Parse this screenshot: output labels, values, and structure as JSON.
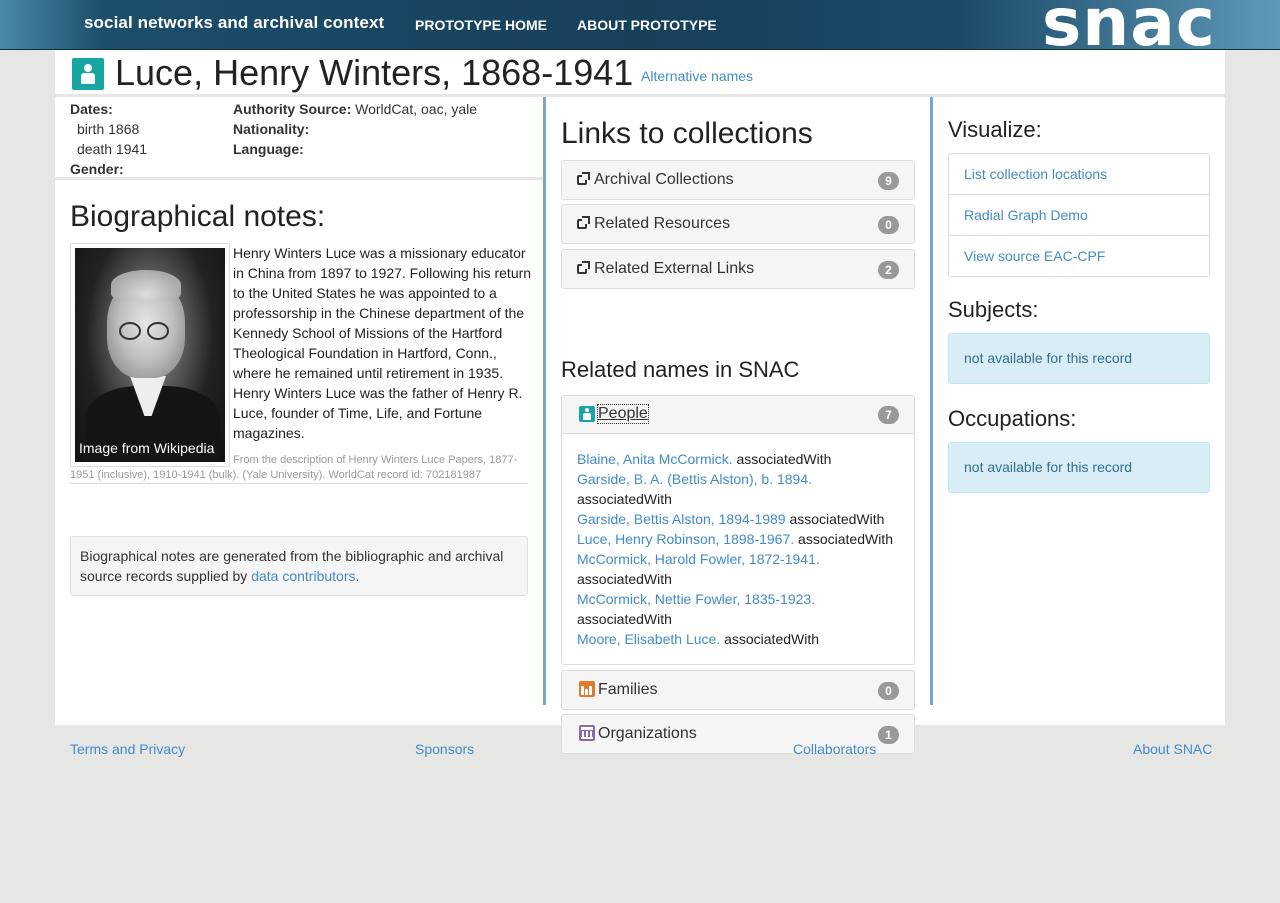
{
  "nav": {
    "brand": "social networks and archival context",
    "home": "PROTOTYPE HOME",
    "about": "ABOUT PROTOTYPE",
    "logo": "snac"
  },
  "header": {
    "title": "Luce, Henry Winters, 1868-1941",
    "alt_names": "Alternative names"
  },
  "facts": {
    "dates_label": "Dates:",
    "birth": "birth 1868",
    "death": "death 1941",
    "gender_label": "Gender:",
    "authority_label": "Authority Source:",
    "authority_value": " WorldCat, oac, yale",
    "nationality_label": "Nationality:",
    "language_label": "Language:"
  },
  "bio": {
    "heading": "Biographical notes:",
    "image_caption": "Image from Wikipedia",
    "text": "Henry Winters Luce was a missionary educator in China from 1897 to 1927. Following his return to the United States he was appointed to a professorship in the Chinese department of the Kennedy School of Missions of the Hartford Theological Foundation in Hartford, Conn., where he remained until retirement in 1935. Henry Winters Luce was the father of Henry R. Luce, founder of Time, Life, and Fortune magazines.",
    "source": "From the description of Henry Winters Luce Papers, 1877-1951 (inclusive), 1910-1941 (bulk). (Yale University). WorldCat record id: 702181987",
    "note_text": "Biographical notes are generated from the bibliographic and archival source records supplied by ",
    "note_link": "data contributors",
    "note_end": "."
  },
  "collections": {
    "heading": "Links to collections",
    "archival": {
      "label": "Archival Collections",
      "count": "9"
    },
    "resources": {
      "label": "Related Resources",
      "count": "0"
    },
    "external": {
      "label": "Related External Links",
      "count": "2"
    }
  },
  "related": {
    "heading": "Related names in SNAC",
    "people": {
      "label": "People",
      "count": "7",
      "items": [
        {
          "name": "Blaine, Anita McCormick.",
          "rel": " associatedWith"
        },
        {
          "name": "Garside, B. A. (Bettis Alston), b. 1894.",
          "rel": " associatedWith"
        },
        {
          "name": "Garside, Bettis Alston, 1894-1989",
          "rel": " associatedWith"
        },
        {
          "name": "Luce, Henry Robinson, 1898-1967.",
          "rel": " associatedWith"
        },
        {
          "name": "McCormick, Harold Fowler, 1872-1941.",
          "rel": " associatedWith"
        },
        {
          "name": "McCormick, Nettie Fowler, 1835-1923.",
          "rel": " associatedWith"
        },
        {
          "name": "Moore, Elisabeth Luce.",
          "rel": " associatedWith"
        }
      ]
    },
    "families": {
      "label": "Families",
      "count": "0"
    },
    "organizations": {
      "label": "Organizations",
      "count": "1"
    }
  },
  "visualize": {
    "heading": "Visualize:",
    "items": [
      "List collection locations",
      "Radial Graph Demo",
      "View source EAC-CPF"
    ]
  },
  "subjects": {
    "heading": "Subjects:",
    "value": "not available for this record"
  },
  "occupations": {
    "heading": "Occupations:",
    "value": "not available for this record"
  },
  "footer": {
    "terms": "Terms and Privacy",
    "sponsors": "Sponsors",
    "collaborators": "Collaborators",
    "about": "About SNAC"
  },
  "colors": {
    "person": "#18a6a4",
    "family": "#e07b2a",
    "organization": "#8a6aa8",
    "link": "#428bca",
    "divider": "#7ba6c5"
  }
}
